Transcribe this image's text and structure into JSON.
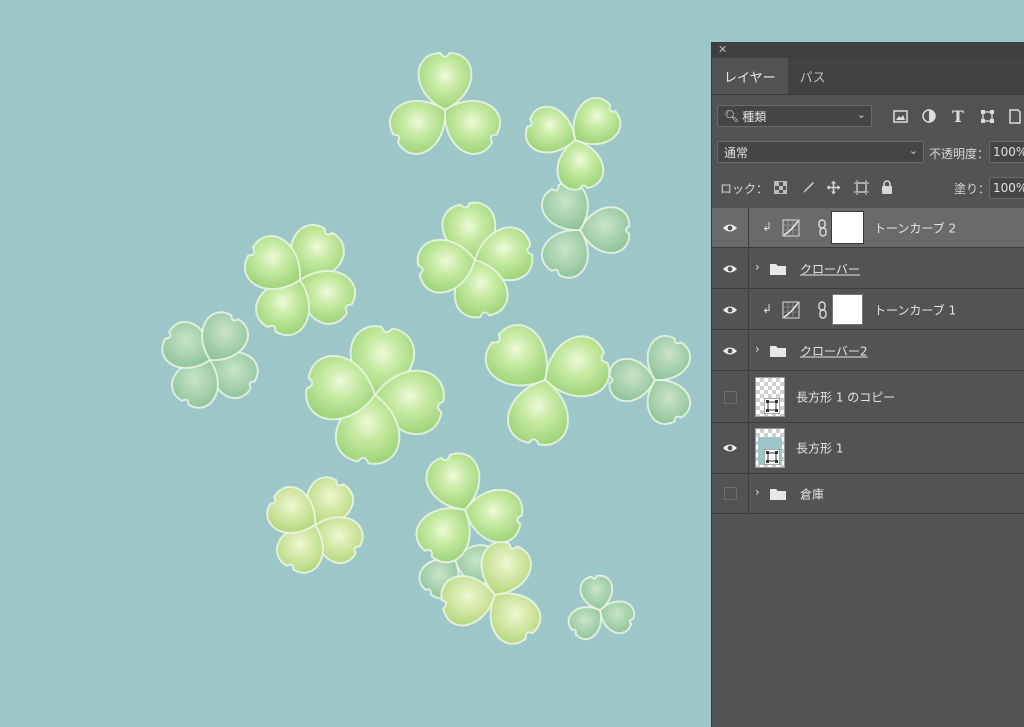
{
  "panel": {
    "tabs": [
      {
        "label": "レイヤー"
      },
      {
        "label": "パス"
      }
    ],
    "filter": {
      "label": "種類"
    },
    "blend_mode": {
      "value": "通常"
    },
    "opacity": {
      "label": "不透明度：",
      "value": "100%"
    },
    "lock": {
      "label": "ロック："
    },
    "fill": {
      "label": "塗り：",
      "value": "100%"
    },
    "layers": [
      {
        "name": "トーンカーブ 2",
        "visible": true,
        "kind": "adjustment",
        "selected": true
      },
      {
        "name": "クローバー",
        "visible": true,
        "kind": "group"
      },
      {
        "name": "トーンカーブ 1",
        "visible": true,
        "kind": "adjustment"
      },
      {
        "name": "クローバー2",
        "visible": true,
        "kind": "group"
      },
      {
        "name": "長方形 1 のコピー",
        "visible": false,
        "kind": "shape"
      },
      {
        "name": "長方形 1",
        "visible": true,
        "kind": "shape"
      },
      {
        "name": "倉庫",
        "visible": false,
        "kind": "group"
      }
    ]
  },
  "canvas": {
    "background_color": "#9cc6c8"
  }
}
